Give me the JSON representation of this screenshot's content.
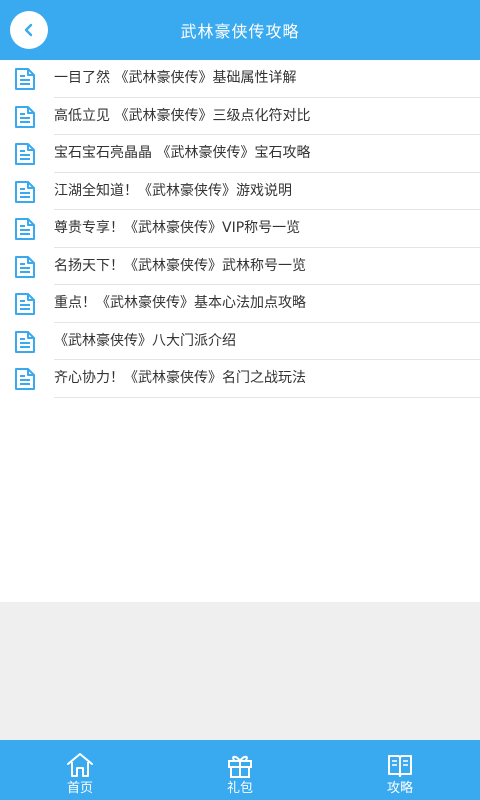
{
  "header": {
    "title": "武林豪侠传攻略",
    "back_icon": "chevron-left-icon"
  },
  "list": {
    "items": [
      "一目了然 《武林豪侠传》基础属性详解",
      "高低立见 《武林豪侠传》三级点化符对比",
      "宝石宝石亮晶晶 《武林豪侠传》宝石攻略",
      "江湖全知道！《武林豪侠传》游戏说明",
      "尊贵专享！《武林豪侠传》VIP称号一览",
      "名扬天下！《武林豪侠传》武林称号一览",
      "重点！《武林豪侠传》基本心法加点攻略",
      "《武林豪侠传》八大门派介绍",
      "齐心协力！《武林豪侠传》名门之战玩法"
    ]
  },
  "tabbar": {
    "tabs": [
      {
        "label": "首页",
        "icon": "home-icon"
      },
      {
        "label": "礼包",
        "icon": "gift-icon"
      },
      {
        "label": "攻略",
        "icon": "book-icon"
      }
    ]
  },
  "colors": {
    "primary": "#3aaaf0",
    "text": "#333333",
    "divider": "#e4e4e4",
    "background": "#efefef"
  }
}
